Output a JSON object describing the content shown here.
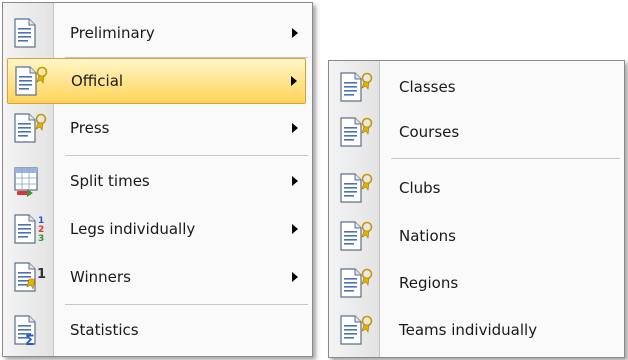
{
  "main_menu": {
    "items": [
      {
        "label": "Preliminary",
        "icon": "document-icon",
        "submenu": true
      },
      {
        "label": "Official",
        "icon": "document-medal-icon",
        "submenu": true,
        "highlighted": true
      },
      {
        "label": "Press",
        "icon": "document-medal-icon",
        "submenu": true
      },
      {
        "label": "Split times",
        "icon": "split-times-table-icon",
        "submenu": true
      },
      {
        "label": "Legs individually",
        "icon": "document-ranking-icon",
        "submenu": true
      },
      {
        "label": "Winners",
        "icon": "document-winner-icon",
        "submenu": true
      },
      {
        "label": "Statistics",
        "icon": "document-sigma-icon",
        "submenu": false
      }
    ]
  },
  "sub_menu": {
    "items": [
      {
        "label": "Classes",
        "icon": "document-medal-icon"
      },
      {
        "label": "Courses",
        "icon": "document-medal-icon"
      },
      {
        "label": "Clubs",
        "icon": "document-medal-icon"
      },
      {
        "label": "Nations",
        "icon": "document-medal-icon"
      },
      {
        "label": "Regions",
        "icon": "document-medal-icon"
      },
      {
        "label": "Teams individually",
        "icon": "document-medal-icon"
      }
    ]
  },
  "colors": {
    "highlight_top": "#fff6c8",
    "highlight_bottom": "#ffd35a",
    "highlight_border": "#d8a23b",
    "icon_blue": "#3a5f9e",
    "medal_gold": "#e0b400"
  }
}
